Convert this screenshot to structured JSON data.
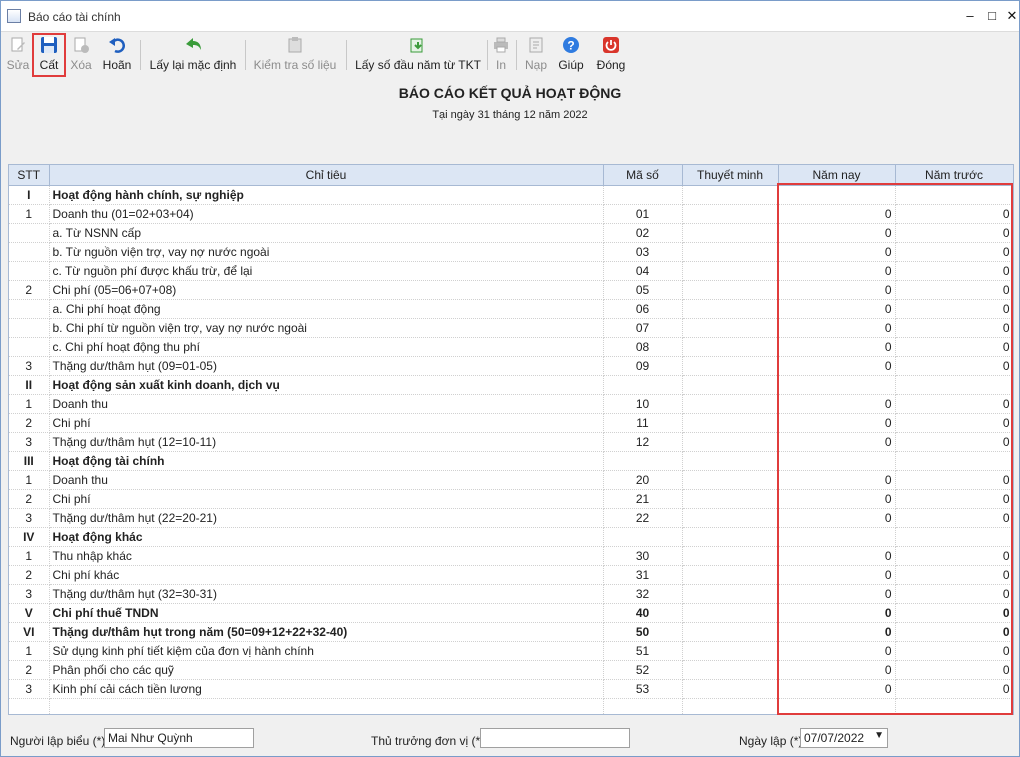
{
  "window": {
    "title": "Báo cáo tài chính",
    "controls": [
      "–",
      "□",
      "✕"
    ]
  },
  "toolbar": [
    {
      "label": "Sửa",
      "icon": "edit-icon",
      "disabled": true
    },
    {
      "label": "Cất",
      "icon": "save-icon",
      "disabled": false
    },
    {
      "label": "Xóa",
      "icon": "delete-icon",
      "disabled": true
    },
    {
      "label": "Hoãn",
      "icon": "undo-icon",
      "disabled": false
    },
    {
      "label": "Lấy lại mặc định",
      "icon": "back-arrow-icon",
      "disabled": false
    },
    {
      "label": "Kiểm tra số liệu",
      "icon": "check-data-icon",
      "disabled": true
    },
    {
      "label": "Lấy số đầu năm từ TKT",
      "icon": "import-icon",
      "disabled": false
    },
    {
      "label": "In",
      "icon": "print-icon",
      "disabled": true
    },
    {
      "label": "Nạp",
      "icon": "load-icon",
      "disabled": true
    },
    {
      "label": "Giúp",
      "icon": "help-icon",
      "disabled": false
    },
    {
      "label": "Đóng",
      "icon": "close-power-icon",
      "disabled": false
    }
  ],
  "report": {
    "title": "BÁO CÁO KẾT QUẢ HOẠT ĐỘNG",
    "date": "Tại ngày 31 tháng 12 năm 2022"
  },
  "table": {
    "headers": [
      "STT",
      "Chỉ tiêu",
      "Mã số",
      "Thuyết minh",
      "Năm nay",
      "Năm trước"
    ],
    "rows": [
      {
        "stt": "I",
        "name": "Hoạt động hành chính, sự nghiệp",
        "code": "",
        "note": "",
        "cur": "",
        "prev": "",
        "bold": true
      },
      {
        "stt": "1",
        "name": "Doanh thu (01=02+03+04)",
        "code": "01",
        "note": "",
        "cur": "0",
        "prev": "0",
        "bold": false
      },
      {
        "stt": "",
        "name": "a. Từ NSNN cấp",
        "code": "02",
        "note": "",
        "cur": "0",
        "prev": "0",
        "bold": false
      },
      {
        "stt": "",
        "name": "b. Từ nguồn viện trợ, vay nợ nước ngoài",
        "code": "03",
        "note": "",
        "cur": "0",
        "prev": "0",
        "bold": false
      },
      {
        "stt": "",
        "name": "c. Từ nguồn phí được khấu trừ, để lại",
        "code": "04",
        "note": "",
        "cur": "0",
        "prev": "0",
        "bold": false
      },
      {
        "stt": "2",
        "name": "Chi phí (05=06+07+08)",
        "code": "05",
        "note": "",
        "cur": "0",
        "prev": "0",
        "bold": false
      },
      {
        "stt": "",
        "name": "a. Chi phí hoạt động",
        "code": "06",
        "note": "",
        "cur": "0",
        "prev": "0",
        "bold": false
      },
      {
        "stt": "",
        "name": "b. Chi phí từ nguồn viện trợ, vay nợ nước ngoài",
        "code": "07",
        "note": "",
        "cur": "0",
        "prev": "0",
        "bold": false
      },
      {
        "stt": "",
        "name": "c. Chi phí hoạt động thu phí",
        "code": "08",
        "note": "",
        "cur": "0",
        "prev": "0",
        "bold": false
      },
      {
        "stt": "3",
        "name": "Thặng dư/thâm hụt (09=01-05)",
        "code": "09",
        "note": "",
        "cur": "0",
        "prev": "0",
        "bold": false
      },
      {
        "stt": "II",
        "name": "Hoạt động sản xuất kinh doanh, dịch vụ",
        "code": "",
        "note": "",
        "cur": "",
        "prev": "",
        "bold": true
      },
      {
        "stt": "1",
        "name": "Doanh thu",
        "code": "10",
        "note": "",
        "cur": "0",
        "prev": "0",
        "bold": false
      },
      {
        "stt": "2",
        "name": "Chi phí",
        "code": "11",
        "note": "",
        "cur": "0",
        "prev": "0",
        "bold": false
      },
      {
        "stt": "3",
        "name": "Thặng dư/thâm hụt (12=10-11)",
        "code": "12",
        "note": "",
        "cur": "0",
        "prev": "0",
        "bold": false
      },
      {
        "stt": "III",
        "name": "Hoạt động tài chính",
        "code": "",
        "note": "",
        "cur": "",
        "prev": "",
        "bold": true
      },
      {
        "stt": "1",
        "name": "Doanh thu",
        "code": "20",
        "note": "",
        "cur": "0",
        "prev": "0",
        "bold": false
      },
      {
        "stt": "2",
        "name": "Chi phí",
        "code": "21",
        "note": "",
        "cur": "0",
        "prev": "0",
        "bold": false
      },
      {
        "stt": "3",
        "name": "Thặng dư/thâm hụt (22=20-21)",
        "code": "22",
        "note": "",
        "cur": "0",
        "prev": "0",
        "bold": false
      },
      {
        "stt": "IV",
        "name": "Hoạt động khác",
        "code": "",
        "note": "",
        "cur": "",
        "prev": "",
        "bold": true
      },
      {
        "stt": "1",
        "name": "Thu nhập khác",
        "code": "30",
        "note": "",
        "cur": "0",
        "prev": "0",
        "bold": false
      },
      {
        "stt": "2",
        "name": "Chi phí khác",
        "code": "31",
        "note": "",
        "cur": "0",
        "prev": "0",
        "bold": false
      },
      {
        "stt": "3",
        "name": "Thặng dư/thâm hụt (32=30-31)",
        "code": "32",
        "note": "",
        "cur": "0",
        "prev": "0",
        "bold": false
      },
      {
        "stt": "V",
        "name": "Chi phí thuế TNDN",
        "code": "40",
        "note": "",
        "cur": "0",
        "prev": "0",
        "bold": true
      },
      {
        "stt": "VI",
        "name": "Thặng dư/thâm hụt trong năm (50=09+12+22+32-40)",
        "code": "50",
        "note": "",
        "cur": "0",
        "prev": "0",
        "bold": true
      },
      {
        "stt": "1",
        "name": "Sử dụng kinh phí tiết kiệm của đơn vị hành chính",
        "code": "51",
        "note": "",
        "cur": "0",
        "prev": "0",
        "bold": false
      },
      {
        "stt": "2",
        "name": "Phân phối cho các quỹ",
        "code": "52",
        "note": "",
        "cur": "0",
        "prev": "0",
        "bold": false
      },
      {
        "stt": "3",
        "name": "Kinh phí cải cách tiền lương",
        "code": "53",
        "note": "",
        "cur": "0",
        "prev": "0",
        "bold": false
      },
      {
        "stt": "",
        "name": "",
        "code": "",
        "note": "",
        "cur": "",
        "prev": "",
        "bold": false
      }
    ]
  },
  "footer": {
    "preparer_label": "Người lập biểu (*)",
    "preparer_value": "Mai Như Quỳnh",
    "head_label": "Thủ trưởng đơn vị (*)",
    "head_value": "",
    "date_label": "Ngày lập (*)",
    "date_value": "07/07/2022"
  },
  "colors": {
    "highlight": "#e03c3c",
    "header_bg": "#dce6f4"
  }
}
